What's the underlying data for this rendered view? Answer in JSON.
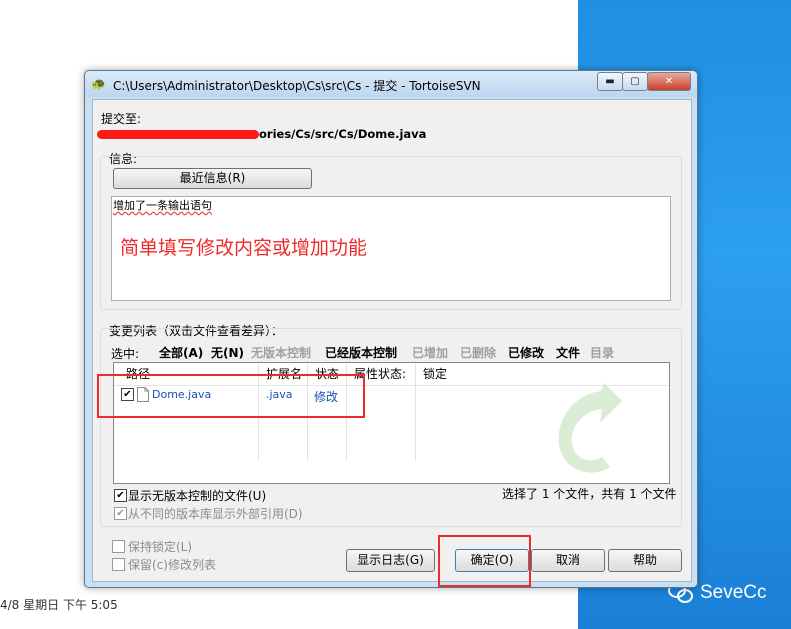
{
  "dialog": {
    "title": "C:\\Users\\Administrator\\Desktop\\Cs\\src\\Cs - 提交 - TortoiseSVN",
    "controls": {
      "minimize": "▬",
      "maximize": "▢",
      "close": "✕"
    }
  },
  "commit_to": {
    "label": "提交至:",
    "url_tail": "ories/Cs/src/Cs/Dome.java"
  },
  "message": {
    "label": "信息:",
    "recent_button": "最近信息(R)",
    "text": "增加了一条输出语句",
    "annotation": "简单填写修改内容或增加功能"
  },
  "changes": {
    "label": "变更列表（双击文件查看差异）：",
    "select_label": "选中:",
    "select_items": [
      {
        "label": "全部(A)",
        "enabled": true
      },
      {
        "label": "无(N)",
        "enabled": true
      },
      {
        "label": "无版本控制",
        "enabled": false
      },
      {
        "label": "已经版本控制",
        "enabled": true
      },
      {
        "label": "已增加",
        "enabled": false
      },
      {
        "label": "已删除",
        "enabled": false
      },
      {
        "label": "已修改",
        "enabled": true
      },
      {
        "label": "文件",
        "enabled": true
      },
      {
        "label": "目录",
        "enabled": false
      }
    ],
    "columns": [
      "路径",
      "扩展名",
      "状态",
      "属性状态:",
      "锁定"
    ],
    "rows": [
      {
        "checked": true,
        "path": "Dome.java",
        "ext": ".java",
        "status": "修改"
      }
    ],
    "show_unversioned": {
      "label": "显示无版本控制的文件(U)",
      "checked": true
    },
    "show_externals": {
      "label": "从不同的版本库显示外部引用(D)",
      "checked": true
    },
    "summary": "选择了 1 个文件，共有 1 个文件"
  },
  "options": {
    "keep_locks": "保持锁定(L)",
    "keep_changelists": "保留(c)修改列表"
  },
  "buttons": {
    "show_log": "显示日志(G)",
    "ok": "确定(O)",
    "cancel": "取消",
    "help": "帮助"
  },
  "taskbar": {
    "datetime": "4/8 星期日 下午 5:05"
  },
  "watermark": {
    "text": "SeveCc"
  },
  "colors": {
    "annotation_red": "#f02a2a",
    "link_blue": "#1a4fb0",
    "desktop_blue": "#2d9ff0"
  }
}
